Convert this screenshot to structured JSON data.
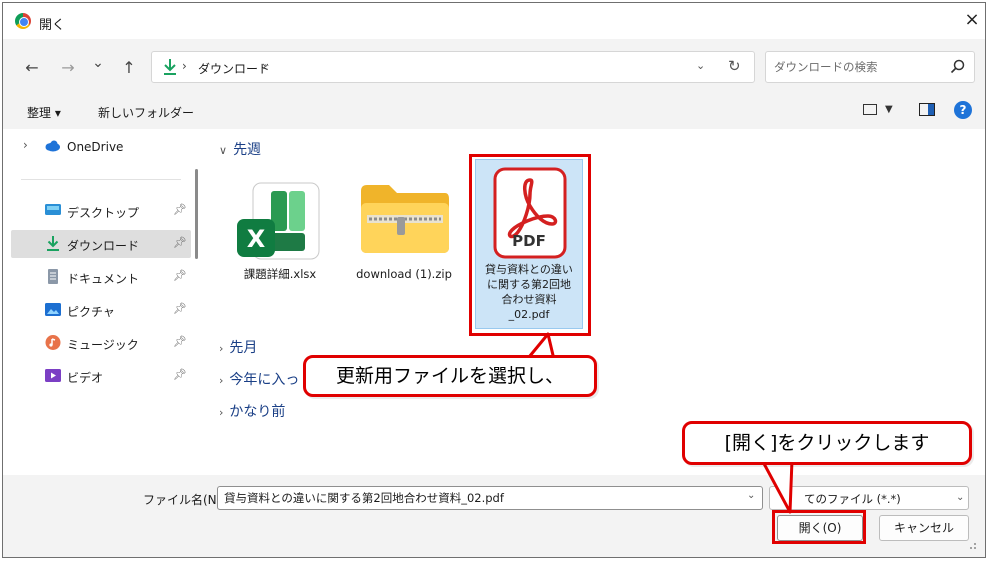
{
  "window": {
    "title": "開く",
    "close_glyph": "×"
  },
  "nav": {
    "back": "←",
    "forward": "→",
    "recent": "⌄",
    "up": "↑"
  },
  "address": {
    "chevron": "›",
    "path": "ダウンロード",
    "trail_chevron": "›"
  },
  "search": {
    "placeholder": "ダウンロードの検索"
  },
  "toolbar": {
    "organize": "整理 ▾",
    "new_folder": "新しいフォルダー",
    "help": "?"
  },
  "sidebar": {
    "onedrive": "OneDrive",
    "items": [
      {
        "label": "デスクトップ"
      },
      {
        "label": "ダウンロード"
      },
      {
        "label": "ドキュメント"
      },
      {
        "label": "ピクチャ"
      },
      {
        "label": "ミュージック"
      },
      {
        "label": "ビデオ"
      }
    ]
  },
  "groups": {
    "last_week": "先週",
    "last_month": "先月",
    "earlier_year": "今年に入っ",
    "long_ago": "かなり前"
  },
  "files": [
    {
      "name": "課題詳細.xlsx",
      "icon": "excel-icon"
    },
    {
      "name": "download (1).zip",
      "icon": "zip-folder-icon"
    },
    {
      "name_lines": [
        "貸与資料との違い",
        "に関する第2回地",
        "合わせ資料",
        "_02.pdf"
      ],
      "icon": "pdf-icon",
      "badge": "PDF"
    }
  ],
  "footer": {
    "filename_label": "ファイル名(N):",
    "filename_value": "貸与資料との違いに関する第2回地合わせ資料_02.pdf",
    "filetype": "てのファイル (*.*)",
    "open": "開く(O)",
    "cancel": "キャンセル"
  },
  "callouts": {
    "select": "更新用ファイルを選択し、",
    "click": "[開く]をクリックします"
  },
  "colors": {
    "accent": "#1e73d8",
    "highlight_red": "#e00000",
    "selection": "#cce4f7"
  }
}
